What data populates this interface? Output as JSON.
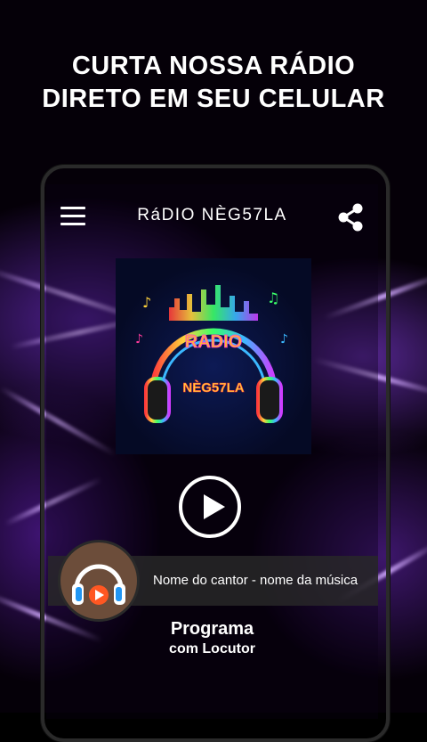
{
  "headline": {
    "line1": "CURTA NOSSA RÁDIO",
    "line2": "DIRETO EM SEU CELULAR"
  },
  "app": {
    "title": "RáDIO NÈG57LA",
    "menu_icon": "hamburger-menu-icon",
    "share_icon": "share-icon"
  },
  "cover": {
    "logo_text_line1": "RADIO",
    "logo_text_line2": "NÈG57LA"
  },
  "player": {
    "play_icon": "play-icon",
    "now_playing": "Nome do cantor - nome da música"
  },
  "program": {
    "title": "Programa",
    "subtitle": "com Locutor"
  },
  "colors": {
    "accent_purple": "#8c3cff",
    "background": "#000000",
    "text": "#ffffff"
  }
}
